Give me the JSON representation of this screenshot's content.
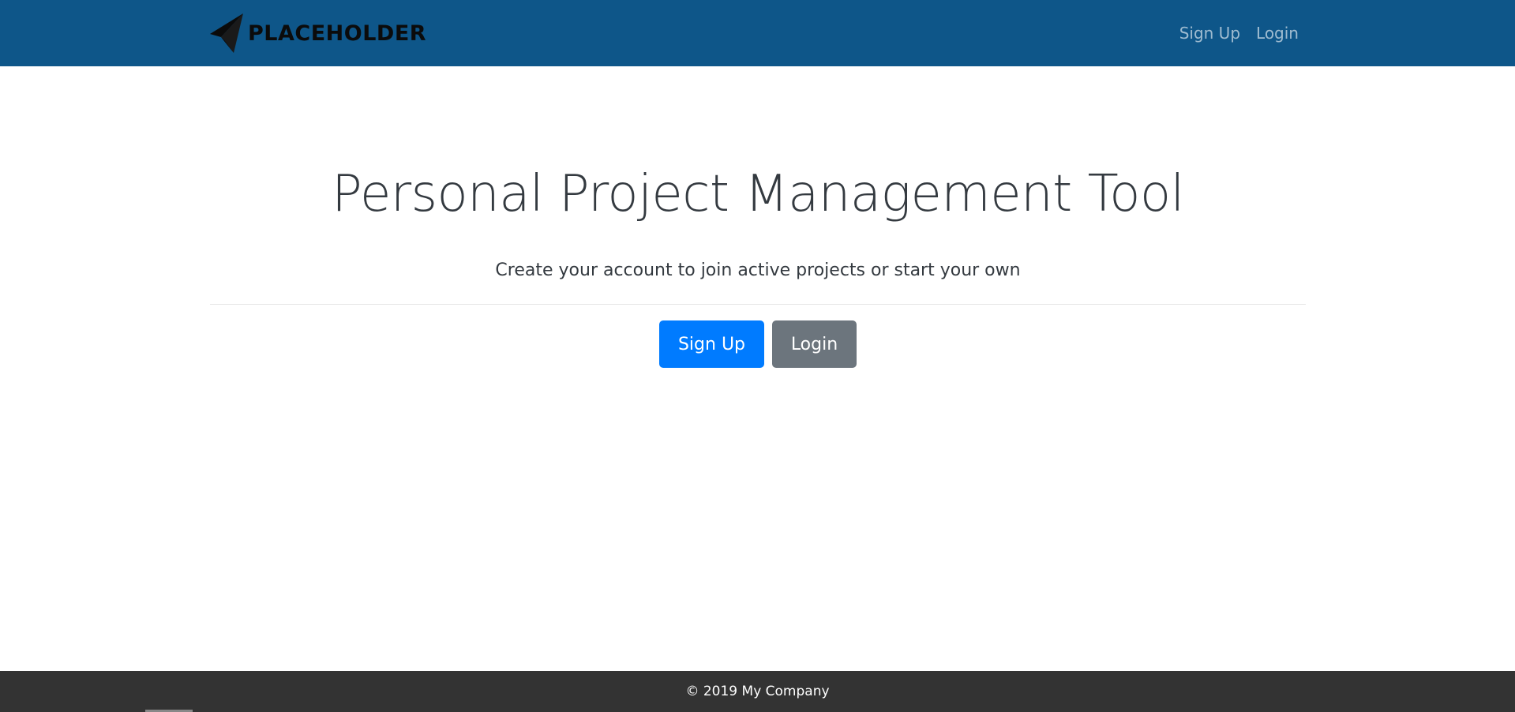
{
  "colors": {
    "navbar_bg": "#0e5689",
    "nav_link": "rgba(255,255,255,0.6)",
    "title_text": "#343a40",
    "primary_button": "#007bff",
    "secondary_button": "#6c757d",
    "footer_bg": "#333333"
  },
  "navbar": {
    "brand": {
      "icon": "paper-plane-logo-icon",
      "text": "PLACEHOLDER"
    },
    "links": [
      {
        "label": "Sign Up"
      },
      {
        "label": "Login"
      }
    ]
  },
  "hero": {
    "title": "Personal Project Management Tool",
    "subtitle": "Create your account to join active projects or start your own",
    "buttons": {
      "signup_label": "Sign Up",
      "login_label": "Login"
    }
  },
  "footer": {
    "text": "© 2019 My Company"
  }
}
